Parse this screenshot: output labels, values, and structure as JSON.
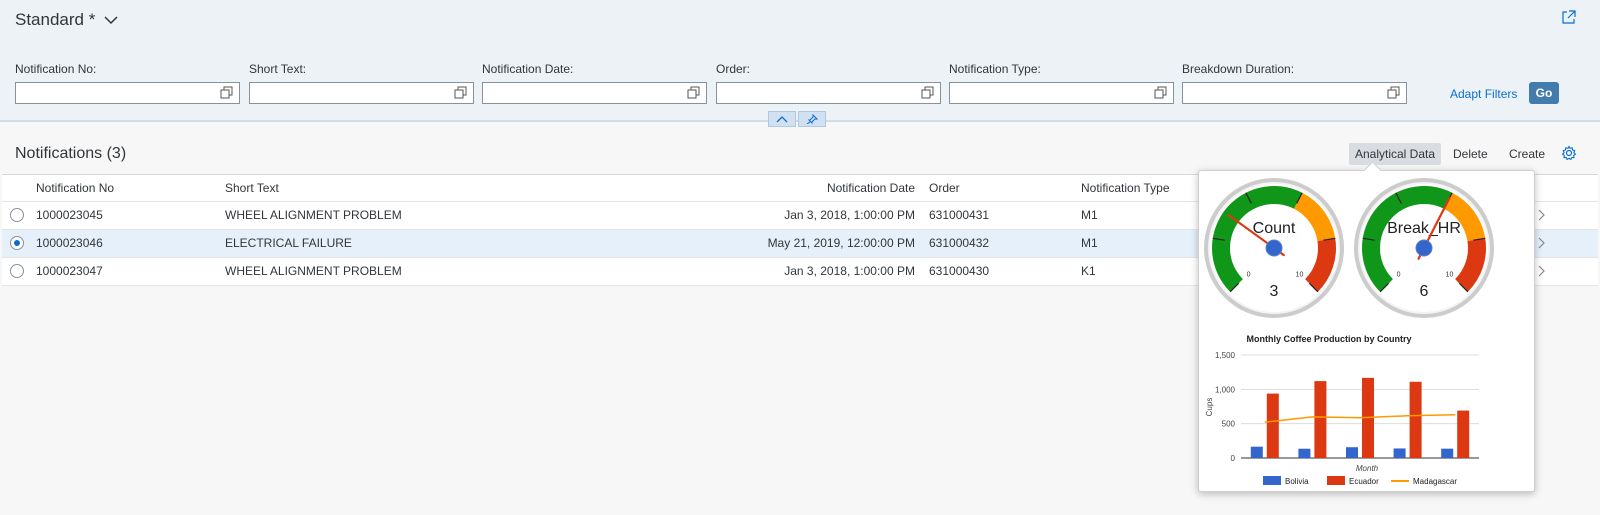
{
  "header": {
    "variant_title": "Standard *",
    "filters": [
      {
        "label": "Notification No:",
        "value": ""
      },
      {
        "label": "Short Text:",
        "value": ""
      },
      {
        "label": "Notification Date:",
        "value": ""
      },
      {
        "label": "Order:",
        "value": ""
      },
      {
        "label": "Notification Type:",
        "value": ""
      },
      {
        "label": "Breakdown Duration:",
        "value": ""
      }
    ],
    "adapt_filters": "Adapt Filters",
    "go": "Go"
  },
  "table": {
    "title": "Notifications (3)",
    "toolbar": {
      "analytical_data": "Analytical Data",
      "delete": "Delete",
      "create": "Create"
    },
    "columns": [
      "Notification No",
      "Short Text",
      "Notification Date",
      "Order",
      "Notification Type"
    ],
    "rows": [
      {
        "no": "1000023045",
        "text": "WHEEL ALIGNMENT PROBLEM",
        "date": "Jan 3, 2018, 1:00:00 PM",
        "order": "631000431",
        "type": "M1",
        "selected": false
      },
      {
        "no": "1000023046",
        "text": "ELECTRICAL FAILURE",
        "date": "May 21, 2019, 12:00:00 PM",
        "order": "631000432",
        "type": "M1",
        "selected": true
      },
      {
        "no": "1000023047",
        "text": "WHEEL ALIGNMENT PROBLEM",
        "date": "Jan 3, 2018, 1:00:00 PM",
        "order": "631000430",
        "type": "K1",
        "selected": false
      }
    ]
  },
  "gauges": [
    {
      "label": "Count",
      "value": 3,
      "value_text": "3",
      "min": 0,
      "max": 10,
      "min_text": "0",
      "max_text": "10"
    },
    {
      "label": "Break_HR",
      "value": 6,
      "value_text": "6",
      "min": 0,
      "max": 10,
      "min_text": "0",
      "max_text": "10"
    }
  ],
  "colors": {
    "accent": "#0a6ed1",
    "go_button": "#427cac",
    "gauge_green": "#109618",
    "gauge_orange": "#ff9900",
    "gauge_red": "#dc3912",
    "bolivia": "#3366cc",
    "ecuador": "#dc3912",
    "madagascar": "#ff9900"
  },
  "chart_data": {
    "type": "bar",
    "title": "Monthly Coffee Production by Country",
    "xlabel": "Month",
    "ylabel": "Cups",
    "ylim": [
      0,
      1500
    ],
    "y_ticks": [
      "0",
      "500",
      "1,000",
      "1,500"
    ],
    "categories": [
      "",
      "",
      "",
      "",
      ""
    ],
    "series": [
      {
        "name": "Bolivia",
        "type": "bar",
        "values": [
          165,
          135,
          157,
          139,
          136
        ]
      },
      {
        "name": "Ecuador",
        "type": "bar",
        "values": [
          938,
          1120,
          1167,
          1110,
          691
        ]
      },
      {
        "name": "Madagascar",
        "type": "line",
        "values": [
          522,
          599,
          587,
          615,
          629
        ]
      }
    ],
    "legend": "bottom",
    "grid": true
  }
}
